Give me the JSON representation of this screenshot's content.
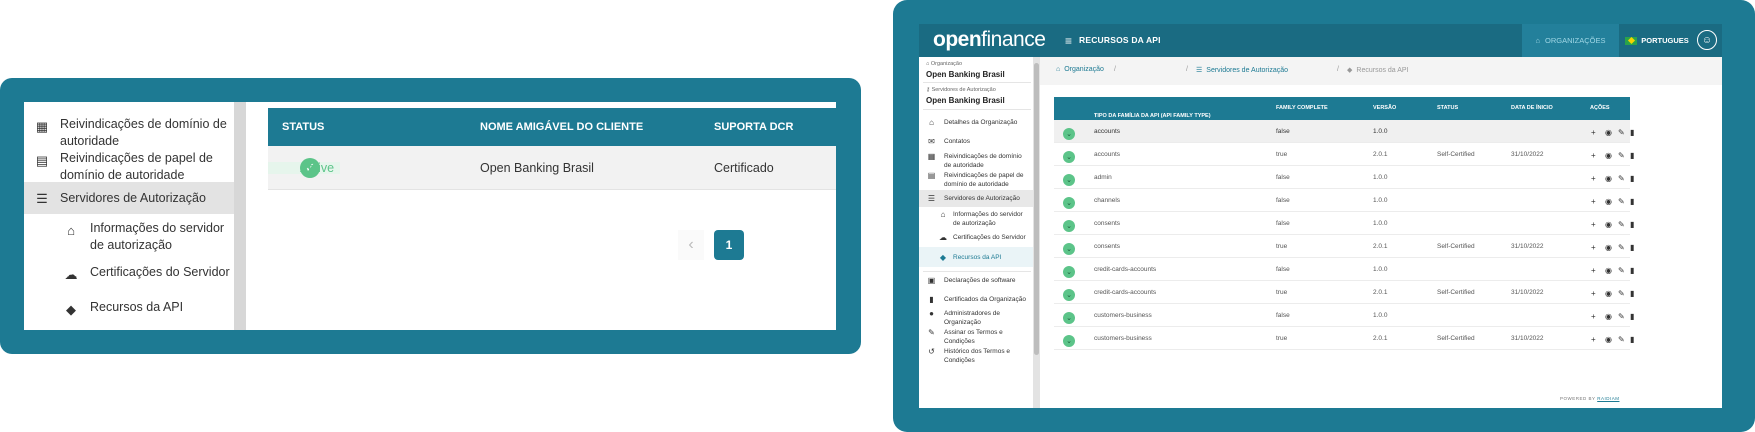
{
  "left_panel": {
    "sidebar": {
      "items": [
        {
          "label": "Reivindicações de domínio de autoridade",
          "icon": "building-icon"
        },
        {
          "label": "Reivindicações de papel de domínio de autoridade",
          "icon": "document-icon"
        },
        {
          "label": "Servidores de Autorização",
          "icon": "server-icon",
          "active": true
        },
        {
          "label": "Informações do servidor de autorização",
          "icon": "bank-icon",
          "sub": true
        },
        {
          "label": "Certificações do Servidor",
          "icon": "cloud-icon",
          "sub": true
        },
        {
          "label": "Recursos da API",
          "icon": "cube-icon",
          "sub": true
        }
      ]
    },
    "table": {
      "headers": [
        "STATUS",
        "NOME AMIGÁVEL DO CLIENTE",
        "SUPORTA DCR"
      ],
      "row": {
        "status": "Active",
        "client_name": "Open Banking Brasil",
        "dcr": "Certificado"
      }
    },
    "pagination": {
      "prev": "‹",
      "current": "1"
    }
  },
  "right_panel": {
    "topbar": {
      "logo_bold": "open",
      "logo_thin": "finance",
      "title": "RECURSOS DA API",
      "org_button": "ORGANIZAÇÕES",
      "language": "PORTUGUES"
    },
    "sidebar": {
      "context": [
        {
          "label": "Organização",
          "value": "Open Banking Brasil"
        },
        {
          "label": "Servidores de Autorização",
          "value": "Open Banking Brasil"
        }
      ],
      "items": [
        {
          "label": "Detalhes da Organização",
          "icon": "bank-icon"
        },
        {
          "label": "Contatos",
          "icon": "mail-icon"
        },
        {
          "label": "Reivindicações de domínio de autoridade",
          "icon": "building-icon"
        },
        {
          "label": "Reivindicações de papel de domínio de autoridade",
          "icon": "document-icon"
        },
        {
          "label": "Servidores de Autorização",
          "icon": "server-icon",
          "active": true
        },
        {
          "label": "Informações do servidor de autorização",
          "icon": "bank-icon",
          "sub": true
        },
        {
          "label": "Certificações do Servidor",
          "icon": "cloud-icon",
          "sub": true
        },
        {
          "label": "Recursos da API",
          "icon": "cube-icon",
          "sub": true,
          "current": true
        },
        {
          "label": "Declarações de software",
          "icon": "software-icon"
        },
        {
          "label": "Certificados da Organização",
          "icon": "certificate-icon"
        },
        {
          "label": "Administradores de Organização",
          "icon": "person-icon"
        },
        {
          "label": "Assinar os Termos e Condições",
          "icon": "sign-icon"
        },
        {
          "label": "Histórico dos Termos e Condições",
          "icon": "history-icon"
        }
      ]
    },
    "breadcrumbs": [
      "Organização",
      "Servidores de Autorização",
      "Recursos da API"
    ],
    "breadcrumb_separator": "/",
    "table": {
      "headers": {
        "family": "TIPO DA FAMÍLIA DA API (API FAMILY TYPE)",
        "complete": "FAMILY COMPLETE",
        "version": "VERSÃO",
        "status": "STATUS",
        "start": "DATA DE ÍNICIO",
        "actions": "AÇÕES"
      },
      "sort_indicator": "↑",
      "rows": [
        {
          "family": "accounts",
          "complete": "false",
          "version": "1.0.0",
          "status": "",
          "start": ""
        },
        {
          "family": "accounts",
          "complete": "true",
          "version": "2.0.1",
          "status": "Self-Certified",
          "start": "31/10/2022"
        },
        {
          "family": "admin",
          "complete": "false",
          "version": "1.0.0",
          "status": "",
          "start": ""
        },
        {
          "family": "channels",
          "complete": "false",
          "version": "1.0.0",
          "status": "",
          "start": ""
        },
        {
          "family": "consents",
          "complete": "false",
          "version": "1.0.0",
          "status": "",
          "start": ""
        },
        {
          "family": "consents",
          "complete": "true",
          "version": "2.0.1",
          "status": "Self-Certified",
          "start": "31/10/2022"
        },
        {
          "family": "credit-cards-accounts",
          "complete": "false",
          "version": "1.0.0",
          "status": "",
          "start": ""
        },
        {
          "family": "credit-cards-accounts",
          "complete": "true",
          "version": "2.0.1",
          "status": "Self-Certified",
          "start": "31/10/2022"
        },
        {
          "family": "customers-business",
          "complete": "false",
          "version": "1.0.0",
          "status": "",
          "start": ""
        },
        {
          "family": "customers-business",
          "complete": "true",
          "version": "2.0.1",
          "status": "Self-Certified",
          "start": "31/10/2022"
        }
      ]
    },
    "powered_by": "POWERED BY",
    "powered_brand": "RAIDIAM"
  },
  "colors": {
    "teal": "#1d7a93",
    "topbar": "#1a6b82",
    "success": "#5cc489"
  }
}
